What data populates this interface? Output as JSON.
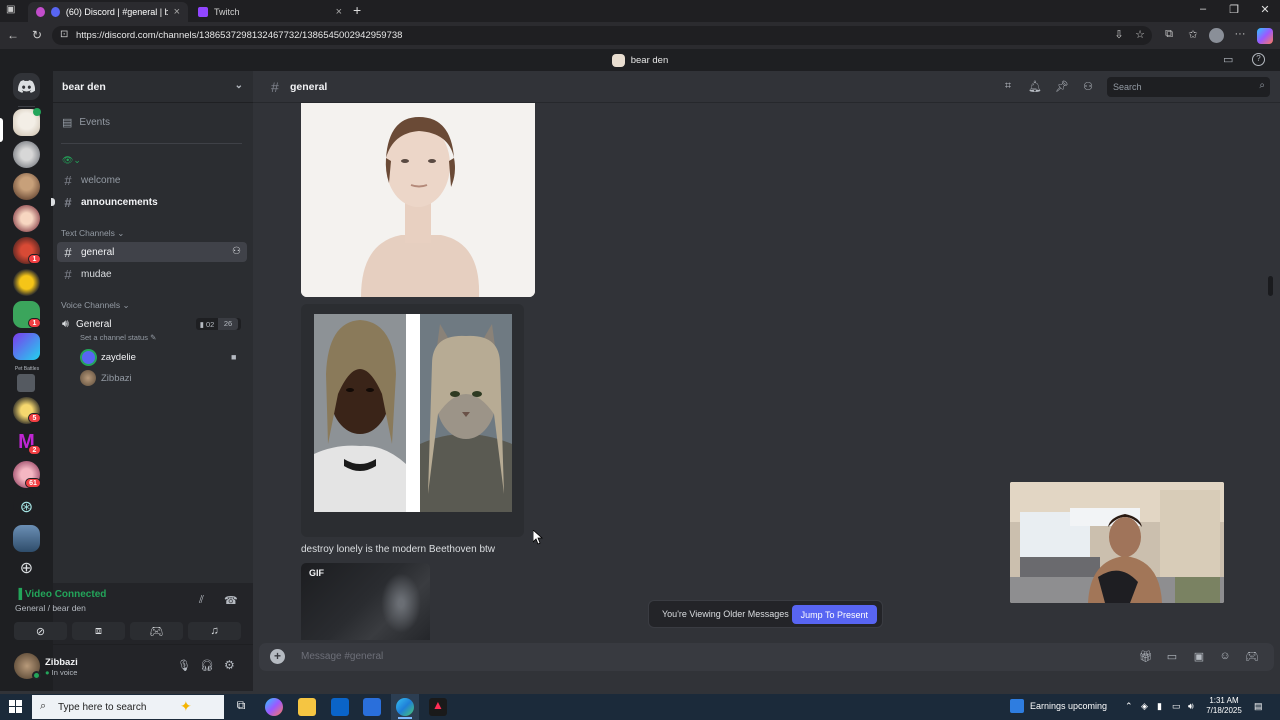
{
  "browser": {
    "tabs": [
      {
        "label": "(60) Discord | #general | bea",
        "active": true
      },
      {
        "label": "Twitch",
        "active": false
      }
    ],
    "url": "https://discord.com/channels/1386537298132467732/1386545002942959738"
  },
  "top_strip": {
    "server_name": "bear den"
  },
  "server_rail": {
    "badges": [
      "1",
      "1",
      "5",
      "2",
      "61"
    ],
    "label_small": "Pet Battles"
  },
  "sidebar": {
    "server_name": "bear den",
    "events_label": "Events",
    "top_channels": [
      "welcome",
      "announcements"
    ],
    "text_category": "Text Channels",
    "text_channels": [
      {
        "name": "general",
        "selected": true
      },
      {
        "name": "mudae",
        "selected": false
      }
    ],
    "voice_category": "Voice Channels",
    "voice_channel": {
      "name": "General",
      "status_placeholder": "Set a channel status",
      "count_left": "02",
      "count_right": "26",
      "members": [
        "zaydelie",
        "Zibbazi"
      ]
    }
  },
  "voice_panel": {
    "status": "Video Connected",
    "location": "General / bear den"
  },
  "user_panel": {
    "username": "Zibbazi",
    "status": "In voice"
  },
  "channel_header": {
    "channel": "general",
    "search_placeholder": "Search"
  },
  "messages": {
    "caption": "destroy lonely is the modern Beethoven btw",
    "gif_label": "GIF"
  },
  "older_messages": {
    "notice": "You're Viewing Older Messages",
    "jump_label": "Jump To Present"
  },
  "composer": {
    "placeholder": "Message #general"
  },
  "taskbar": {
    "search_placeholder": "Type here to search",
    "news": "Earnings upcoming",
    "time": "1:31 AM",
    "date": "7/18/2025"
  },
  "colors": {
    "accent": "#5865f2",
    "online": "#23a55a",
    "badge": "#f23f43"
  }
}
